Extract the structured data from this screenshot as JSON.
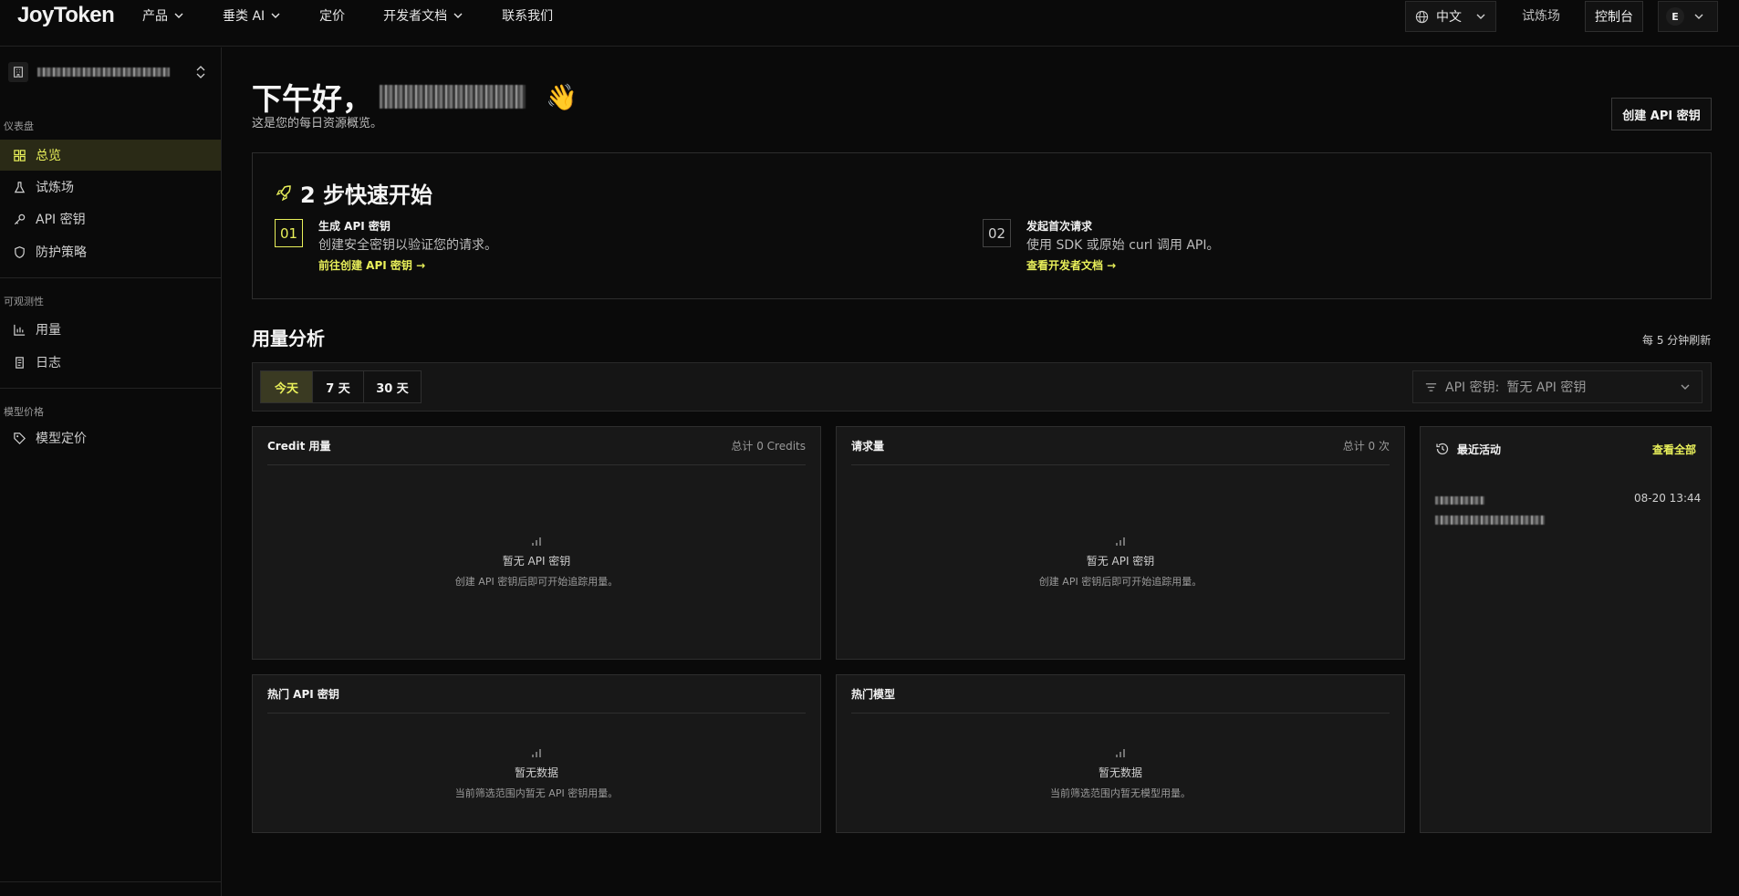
{
  "header": {
    "logo": "JoyToken",
    "nav": [
      {
        "label": "产品",
        "dropdown": true
      },
      {
        "label": "垂类 AI",
        "dropdown": true
      },
      {
        "label": "定价",
        "dropdown": false
      },
      {
        "label": "开发者文档",
        "dropdown": true
      },
      {
        "label": "联系我们",
        "dropdown": false
      }
    ],
    "language": "中文",
    "playground_link": "试炼场",
    "console_button": "控制台",
    "avatar_initial": "E"
  },
  "sidebar": {
    "sections": [
      {
        "title": "仪表盘",
        "items": [
          {
            "label": "总览",
            "icon": "grid-icon",
            "active": true
          },
          {
            "label": "试炼场",
            "icon": "flask-icon",
            "active": false
          },
          {
            "label": "API 密钥",
            "icon": "key-icon",
            "active": false
          },
          {
            "label": "防护策略",
            "icon": "shield-icon",
            "active": false
          }
        ]
      },
      {
        "title": "可观测性",
        "items": [
          {
            "label": "用量",
            "icon": "bar-chart-icon",
            "active": false
          },
          {
            "label": "日志",
            "icon": "log-icon",
            "active": false
          }
        ]
      },
      {
        "title": "模型价格",
        "items": [
          {
            "label": "模型定价",
            "icon": "tag-icon",
            "active": false
          }
        ]
      }
    ]
  },
  "main": {
    "greeting": "下午好，",
    "greeting_emoji": "👋",
    "subtitle": "这是您的每日资源概览。",
    "create_key_button": "创建 API 密钥",
    "quickstart": {
      "title": "2 步快速开始",
      "steps": [
        {
          "num": "01",
          "title": "生成 API 密钥",
          "desc": "创建安全密钥以验证您的请求。",
          "link": "前往创建 API 密钥 →"
        },
        {
          "num": "02",
          "title": "发起首次请求",
          "desc": "使用 SDK 或原始 curl 调用 API。",
          "link": "查看开发者文档 →"
        }
      ]
    },
    "usage": {
      "title": "用量分析",
      "refresh_note": "每 5 分钟刷新",
      "ranges": [
        {
          "label": "今天",
          "active": true
        },
        {
          "label": "7 天",
          "active": false
        },
        {
          "label": "30 天",
          "active": false
        }
      ],
      "key_filter_label": "API 密钥:",
      "key_filter_value": "暂无 API 密钥"
    },
    "cards": {
      "credit": {
        "title": "Credit 用量",
        "meta": "总计 0 Credits",
        "empty_title": "暂无 API 密钥",
        "empty_desc": "创建 API 密钥后即可开始追踪用量。"
      },
      "requests": {
        "title": "请求量",
        "meta": "总计 0 次",
        "empty_title": "暂无 API 密钥",
        "empty_desc": "创建 API 密钥后即可开始追踪用量。"
      },
      "top_keys": {
        "title": "热门 API 密钥",
        "empty_title": "暂无数据",
        "empty_desc": "当前筛选范围内暂无 API 密钥用量。"
      },
      "top_models": {
        "title": "热门模型",
        "empty_title": "暂无数据",
        "empty_desc": "当前筛选范围内暂无模型用量。"
      }
    },
    "activity": {
      "title": "最近活动",
      "view_all": "查看全部",
      "items": [
        {
          "time": "08-20 13:44"
        }
      ]
    }
  },
  "colors": {
    "accent": "#e9f05a",
    "background": "#0a0a0a",
    "card": "#181818",
    "border": "#2e2e2e"
  }
}
